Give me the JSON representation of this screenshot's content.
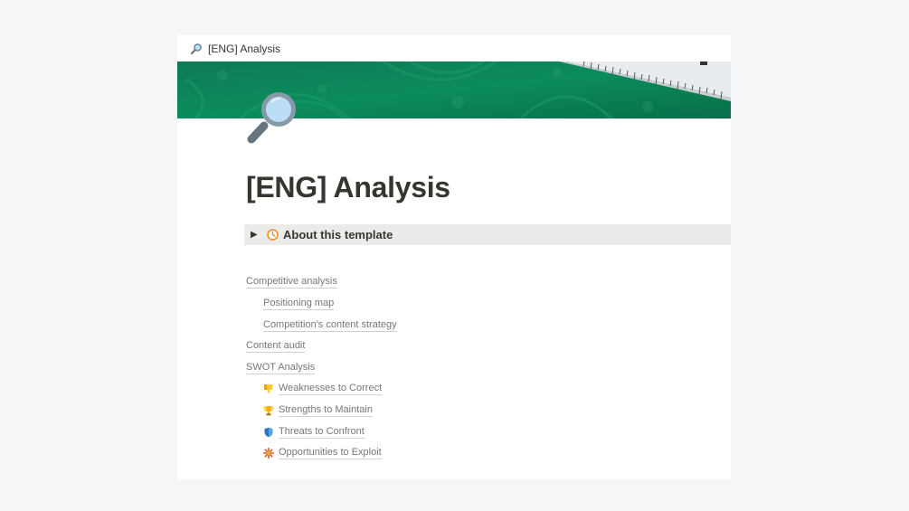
{
  "topbar": {
    "title": "[ENG] Analysis",
    "icon": "magnifier-icon"
  },
  "page": {
    "title": "[ENG] Analysis",
    "cover": "green-textured-cover-with-ruler",
    "icon": "magnifying-glass-icon"
  },
  "toggle": {
    "label": "About this template",
    "icon": "clock-icon",
    "state": "collapsed"
  },
  "links": {
    "competitive_analysis": "Competitive analysis",
    "positioning_map": "Positioning map",
    "competition_content_strategy": "Competition's content strategy",
    "content_audit": "Content audit",
    "swot_analysis": "SWOT Analysis",
    "weaknesses": "Weaknesses to Correct",
    "strengths": "Strengths to Maintain",
    "threats": "Threats to Confront",
    "opportunities": "Opportunities to Exploit"
  },
  "colors": {
    "background": "#f5f6f8",
    "cover": "#0a8a5a",
    "toggle_bg": "#ebebea",
    "link_text": "#787774"
  }
}
